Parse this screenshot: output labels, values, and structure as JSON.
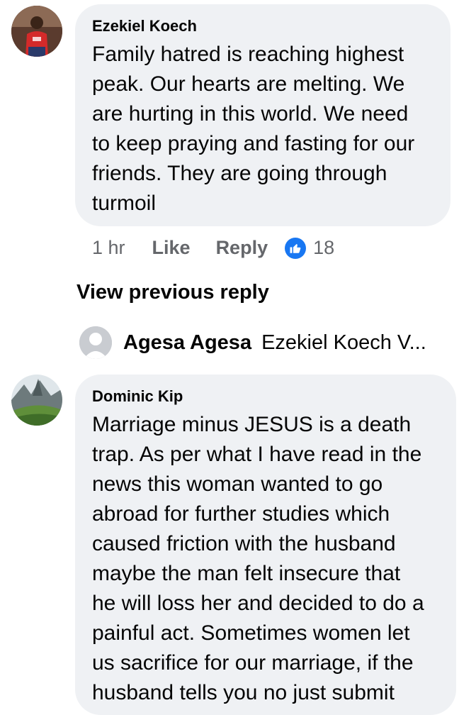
{
  "comments": [
    {
      "author": "Ezekiel Koech",
      "lines": [
        "Family hatred is reaching highest",
        "peak. Our hearts are melting. We",
        "are hurting in this world. We need",
        "to keep praying and fasting for our",
        "friends. They are going through",
        "turmoil"
      ],
      "time": "1 hr",
      "like_label": "Like",
      "reply_label": "Reply",
      "reaction_count": "18",
      "reaction_icon": "like-icon"
    },
    {
      "author": "Dominic Kip",
      "lines": [
        "Marriage minus JESUS is a death",
        "trap. As per what I have read in the",
        "news this woman wanted to go",
        "abroad for further studies which",
        "caused friction with the husband",
        "maybe the man felt insecure that",
        "he will loss her and decided to do a",
        "painful act. Sometimes women let",
        "us sacrifice for our marriage, if the",
        "husband tells you no just submit"
      ]
    }
  ],
  "view_previous": "View previous reply",
  "reply_preview": {
    "name": "Agesa Agesa",
    "snippet": "Ezekiel Koech V..."
  },
  "colors": {
    "bubble": "#eff1f4",
    "meta_text": "#65676b",
    "like_blue": "#1877f2"
  }
}
